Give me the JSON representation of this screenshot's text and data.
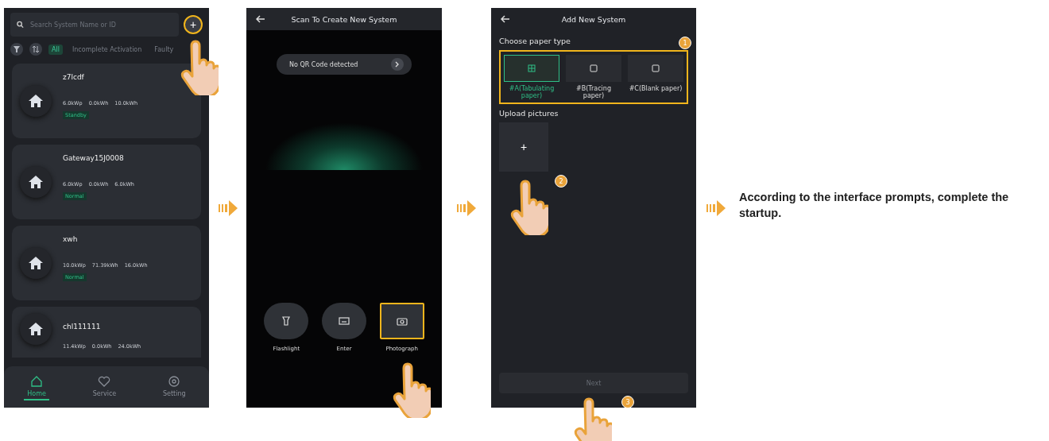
{
  "screens": [
    {
      "kind": "list",
      "search": {
        "placeholder": "Search System Name or ID"
      },
      "add_button": "+",
      "filters": [
        {
          "label": "All",
          "selected": true
        },
        {
          "label": "Incomplete Activation",
          "selected": false
        },
        {
          "label": "Faulty",
          "selected": false
        }
      ],
      "systems": [
        {
          "name": "z7lcdf",
          "capacity": "6.0kWp",
          "today": "0.0kWh",
          "storage": "10.0kWh",
          "status": "Standby"
        },
        {
          "name": "Gateway15J0008",
          "capacity": "6.0kWp",
          "today": "0.0kWh",
          "storage": "6.0kWh",
          "status": "Normal"
        },
        {
          "name": "xwh",
          "capacity": "10.0kWp",
          "today": "71.39kWh",
          "storage": "16.0kWh",
          "status": "Normal"
        },
        {
          "name": "chl111111",
          "capacity": "11.4kWp",
          "today": "0.0kWh",
          "storage": "24.0kWh"
        }
      ],
      "tabs": [
        {
          "label": "Home",
          "selected": true
        },
        {
          "label": "Service",
          "selected": false
        },
        {
          "label": "Setting",
          "selected": false
        }
      ]
    },
    {
      "kind": "scan",
      "title": "Scan To Create New System",
      "notice": "No QR Code detected",
      "actions": [
        {
          "label": "Flashlight",
          "highlighted": false
        },
        {
          "label": "Enter",
          "highlighted": false
        },
        {
          "label": "Photograph",
          "highlighted": true
        }
      ]
    },
    {
      "kind": "form",
      "title": "Add New System",
      "paper_heading": "Choose paper type",
      "step_1": "1",
      "paper_types": [
        {
          "label": "#A(Tabulating paper)",
          "selected": true
        },
        {
          "label": "#B(Tracing paper)",
          "selected": false
        },
        {
          "label": "#C(Blank paper)",
          "selected": false
        }
      ],
      "upload_heading": "Upload pictures",
      "upload_button": "+",
      "step_2": "2",
      "next_button": {
        "label": "Next",
        "disabled": true
      },
      "step_3": "3"
    }
  ],
  "final_note": "According to the interface prompts, complete the startup."
}
